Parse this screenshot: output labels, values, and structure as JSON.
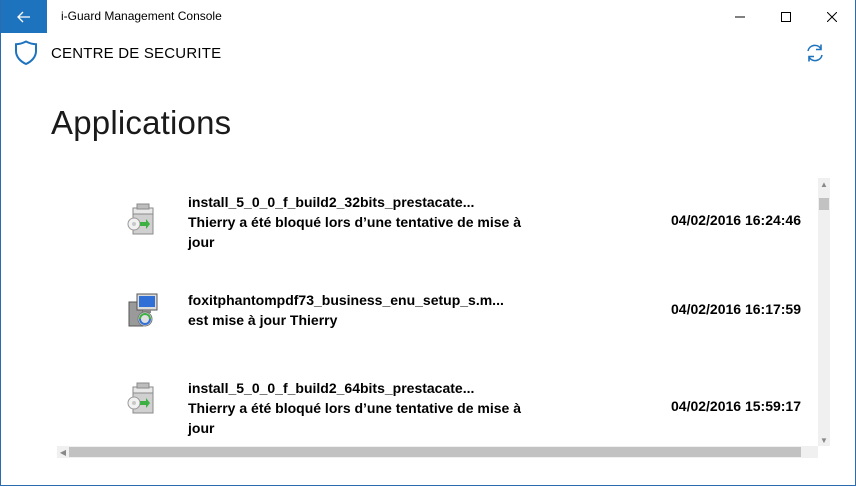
{
  "window": {
    "title": "i-Guard Management Console",
    "accent": "#1e73be"
  },
  "header": {
    "title": "CENTRE DE SECURITE",
    "icon": "shield-icon",
    "refresh_icon": "refresh-icon"
  },
  "page": {
    "title": "Applications"
  },
  "items": [
    {
      "name": "install_5_0_0_f_build2_32bits_prestacate...",
      "line2": "Thierry a été bloqué lors d’une tentative de mise à",
      "line3": "jour",
      "date": "04/02/2016 16:24:46",
      "icon": "installer-box-icon"
    },
    {
      "name": "foxitphantompdf73_business_enu_setup_s.m...",
      "line2": "est mise à jour Thierry",
      "line3": "",
      "date": "04/02/2016 16:17:59",
      "icon": "setup-computer-icon"
    },
    {
      "name": "install_5_0_0_f_build2_64bits_prestacate...",
      "line2": "Thierry a été bloqué lors d’une tentative de mise à",
      "line3": "jour",
      "date": "04/02/2016 15:59:17",
      "icon": "installer-box-icon"
    }
  ]
}
